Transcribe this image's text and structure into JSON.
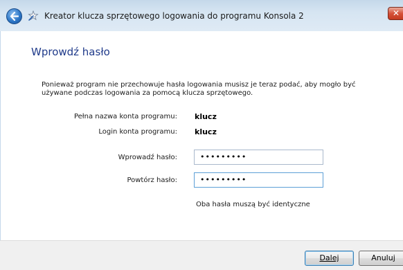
{
  "window": {
    "title": "Kreator klucza sprzętowego logowania do programu Konsola 2",
    "close_symbol": "✕",
    "icons": {
      "back": "back-arrow-icon",
      "wizard": "wizard-icon",
      "close": "close-icon"
    }
  },
  "page": {
    "heading": "Wprowdź hasło",
    "description": "Ponieważ program nie przechowuje hasła logowania musisz je teraz podać, aby mogło być używane podczas logowania za pomocą klucza sprzętowego.",
    "account_name_label": "Pełna nazwa konta programu:",
    "account_name_value": "klucz",
    "login_label": "Login konta programu:",
    "login_value": "klucz",
    "password_label": "Wprowadź hasło:",
    "password_value": "•••••••••",
    "repeat_label": "Powtórz hasło:",
    "repeat_value": "•••••••••",
    "hint": "Oba hasła muszą być identyczne"
  },
  "buttons": {
    "next": "Dalej",
    "cancel": "Anuluj"
  },
  "colors": {
    "heading": "#1f3a8a",
    "titlebar": "#c4d8ea",
    "close_button": "#d5523a"
  }
}
